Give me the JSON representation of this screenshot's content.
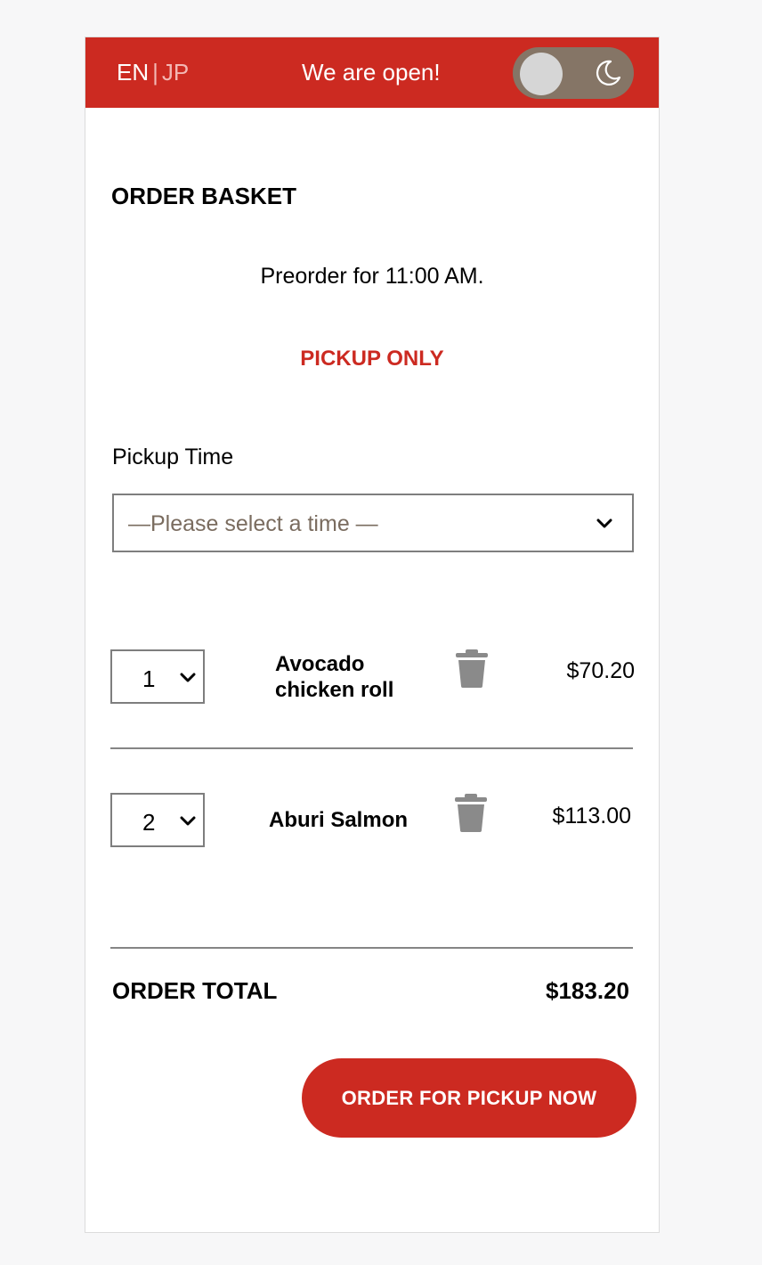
{
  "header": {
    "lang_active": "EN",
    "lang_separator": "|",
    "lang_inactive": "JP",
    "status": "We are open!",
    "theme_toggle_icon": "moon-icon"
  },
  "basket": {
    "title": "ORDER BASKET",
    "preorder_text": "Preorder for 11:00 AM.",
    "pickup_notice": "PICKUP ONLY",
    "pickup_time_label": "Pickup Time",
    "pickup_time_placeholder": "—Please select a time —"
  },
  "items": [
    {
      "qty": "1",
      "name": "Avocado chicken roll",
      "price": "$70.20"
    },
    {
      "qty": "2",
      "name": "Aburi Salmon",
      "price": "$113.00"
    }
  ],
  "total": {
    "label": "ORDER TOTAL",
    "value": "$183.20"
  },
  "cta": {
    "label": "ORDER FOR PICKUP NOW"
  },
  "colors": {
    "brand_red": "#cc2a21",
    "toggle_bg": "#857566",
    "icon_gray": "#8a8a8a"
  }
}
